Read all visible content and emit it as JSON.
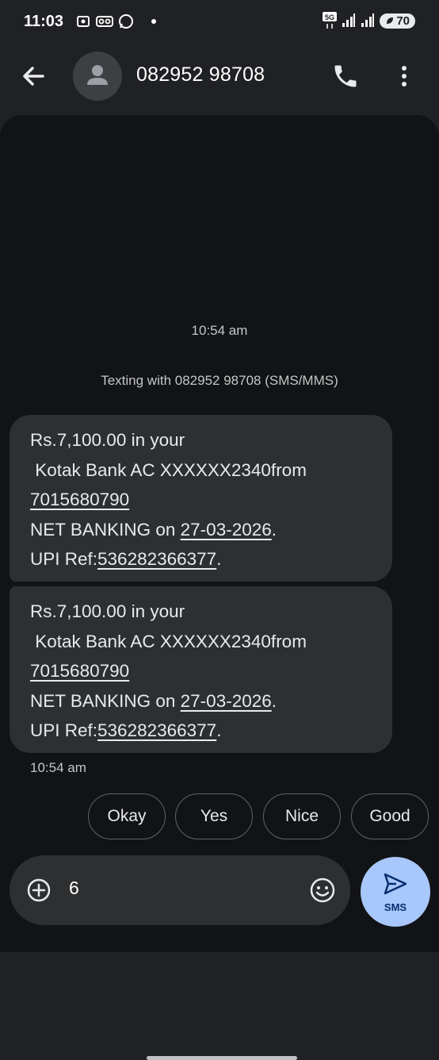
{
  "status_bar": {
    "time": "11:03",
    "network": "5G",
    "battery": "70"
  },
  "header": {
    "title": "082952 98708"
  },
  "conversation": {
    "timestamp_top": "10:54 am",
    "texting_with": "Texting with 082952 98708 (SMS/MMS)",
    "messages": [
      {
        "line1": "Rs.7,100.00 in your",
        "line2": " Kotak Bank AC XXXXXX2340from",
        "phone": "7015680790",
        "line4_prefix": "NET BANKING on ",
        "date": "27-03-2026",
        "line4_suffix": ".",
        "line5_prefix": "UPI Ref:",
        "ref": "536282366377",
        "line5_suffix": "."
      },
      {
        "line1": "Rs.7,100.00 in your",
        "line2": " Kotak Bank AC XXXXXX2340from",
        "phone": "7015680790",
        "line4_prefix": "NET BANKING on ",
        "date": "27-03-2026",
        "line4_suffix": ".",
        "line5_prefix": "UPI Ref:",
        "ref": "536282366377",
        "line5_suffix": "."
      }
    ],
    "message_time": "10:54 am"
  },
  "smart_replies": [
    "Okay",
    "Yes",
    "Nice",
    "Good"
  ],
  "compose": {
    "text": "6",
    "send_label": "SMS"
  },
  "colors": {
    "background": "#202124",
    "conversation_bg": "#121316",
    "bubble": "#2d2f31",
    "send_button": "#a8c7fa"
  },
  "icons": [
    "back-arrow-icon",
    "person-icon",
    "phone-icon",
    "more-vert-icon",
    "add-circle-icon",
    "emoji-icon",
    "send-icon"
  ]
}
